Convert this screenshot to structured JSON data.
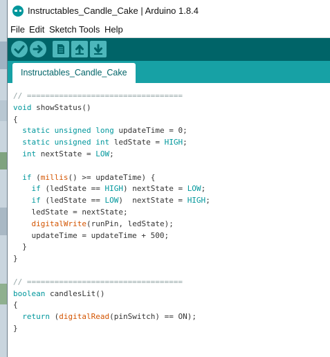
{
  "window": {
    "title": "Instructables_Candle_Cake | Arduino 1.8.4"
  },
  "menu": [
    "File",
    "Edit",
    "Sketch",
    "Tools",
    "Help"
  ],
  "toolbar": {
    "buttons": [
      {
        "name": "verify-button",
        "icon": "check-icon"
      },
      {
        "name": "upload-button",
        "icon": "arrow-right-icon"
      },
      {
        "name": "new-button",
        "icon": "new-file-icon"
      },
      {
        "name": "open-button",
        "icon": "arrow-up-icon"
      },
      {
        "name": "save-button",
        "icon": "arrow-down-icon"
      }
    ]
  },
  "tabs": [
    {
      "label": "Instructables_Candle_Cake"
    }
  ],
  "colors": {
    "toolbar": "#006468",
    "tabstrip": "#17a1a5",
    "keyword": "#00979c",
    "function": "#d35400",
    "comment": "#95a5a6"
  },
  "code": {
    "lines": [
      [
        [
          "c",
          "// =================================="
        ]
      ],
      [
        [
          "k",
          "void"
        ],
        [
          "p",
          " showStatus()"
        ]
      ],
      [
        [
          "p",
          "{"
        ]
      ],
      [
        [
          "p",
          "  "
        ],
        [
          "k",
          "static"
        ],
        [
          "p",
          " "
        ],
        [
          "k",
          "unsigned"
        ],
        [
          "p",
          " "
        ],
        [
          "k",
          "long"
        ],
        [
          "p",
          " updateTime = 0;"
        ]
      ],
      [
        [
          "p",
          "  "
        ],
        [
          "k",
          "static"
        ],
        [
          "p",
          " "
        ],
        [
          "k",
          "unsigned"
        ],
        [
          "p",
          " "
        ],
        [
          "k",
          "int"
        ],
        [
          "p",
          " ledState = "
        ],
        [
          "k",
          "HIGH"
        ],
        [
          "p",
          ";"
        ]
      ],
      [
        [
          "p",
          "  "
        ],
        [
          "k",
          "int"
        ],
        [
          "p",
          " nextState = "
        ],
        [
          "k",
          "LOW"
        ],
        [
          "p",
          ";"
        ]
      ],
      [
        [
          "p",
          ""
        ]
      ],
      [
        [
          "p",
          "  "
        ],
        [
          "k",
          "if"
        ],
        [
          "p",
          " ("
        ],
        [
          "f",
          "millis"
        ],
        [
          "p",
          "() >= updateTime) {"
        ]
      ],
      [
        [
          "p",
          "    "
        ],
        [
          "k",
          "if"
        ],
        [
          "p",
          " (ledState == "
        ],
        [
          "k",
          "HIGH"
        ],
        [
          "p",
          ") nextState = "
        ],
        [
          "k",
          "LOW"
        ],
        [
          "p",
          ";"
        ]
      ],
      [
        [
          "p",
          "    "
        ],
        [
          "k",
          "if"
        ],
        [
          "p",
          " (ledState == "
        ],
        [
          "k",
          "LOW"
        ],
        [
          "p",
          ")  nextState = "
        ],
        [
          "k",
          "HIGH"
        ],
        [
          "p",
          ";"
        ]
      ],
      [
        [
          "p",
          "    ledState = nextState;"
        ]
      ],
      [
        [
          "p",
          "    "
        ],
        [
          "f",
          "digitalWrite"
        ],
        [
          "p",
          "(runPin, ledState);"
        ]
      ],
      [
        [
          "p",
          "    updateTime = updateTime + 500;"
        ]
      ],
      [
        [
          "p",
          "  }"
        ]
      ],
      [
        [
          "p",
          "}"
        ]
      ],
      [
        [
          "p",
          ""
        ]
      ],
      [
        [
          "c",
          "// =================================="
        ]
      ],
      [
        [
          "k",
          "boolean"
        ],
        [
          "p",
          " candlesLit()"
        ]
      ],
      [
        [
          "p",
          "{"
        ]
      ],
      [
        [
          "p",
          "  "
        ],
        [
          "k",
          "return"
        ],
        [
          "p",
          " ("
        ],
        [
          "f",
          "digitalRead"
        ],
        [
          "p",
          "(pinSwitch) == ON);"
        ]
      ],
      [
        [
          "p",
          "}"
        ]
      ]
    ]
  }
}
